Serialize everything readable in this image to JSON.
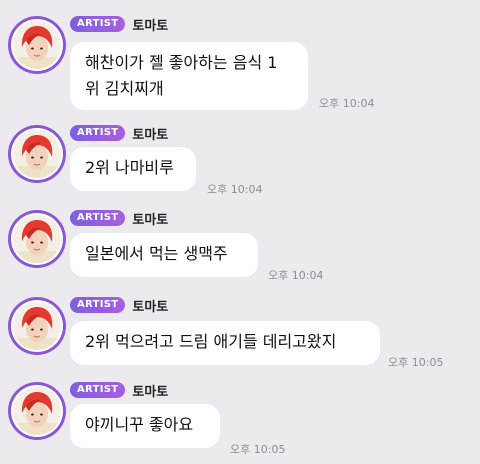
{
  "sender": {
    "badge": "ARTIST",
    "name": "토마토"
  },
  "colors": {
    "background": "#eceaef",
    "bubble": "#ffffff",
    "badge_start": "#7d5fe0",
    "badge_end": "#a85fe0",
    "avatar_ring": "#8a58d6",
    "hair": "#e23a2f",
    "timestamp": "#8f8c95"
  },
  "messages": [
    {
      "lines": [
        "해찬이가 젤 좋아하는 음식 1",
        "위 김치찌개"
      ],
      "time": "오후 10:04"
    },
    {
      "lines": [
        "2위 나마비루"
      ],
      "time": "오후 10:04"
    },
    {
      "lines": [
        "일본에서 먹는 생맥주"
      ],
      "time": "오후 10:04"
    },
    {
      "lines": [
        "2위 먹으려고 드림 애기들 데리고왔지"
      ],
      "time": "오후 10:05"
    },
    {
      "lines": [
        "야끼니꾸 좋아요"
      ],
      "time": "오후 10:05"
    }
  ]
}
